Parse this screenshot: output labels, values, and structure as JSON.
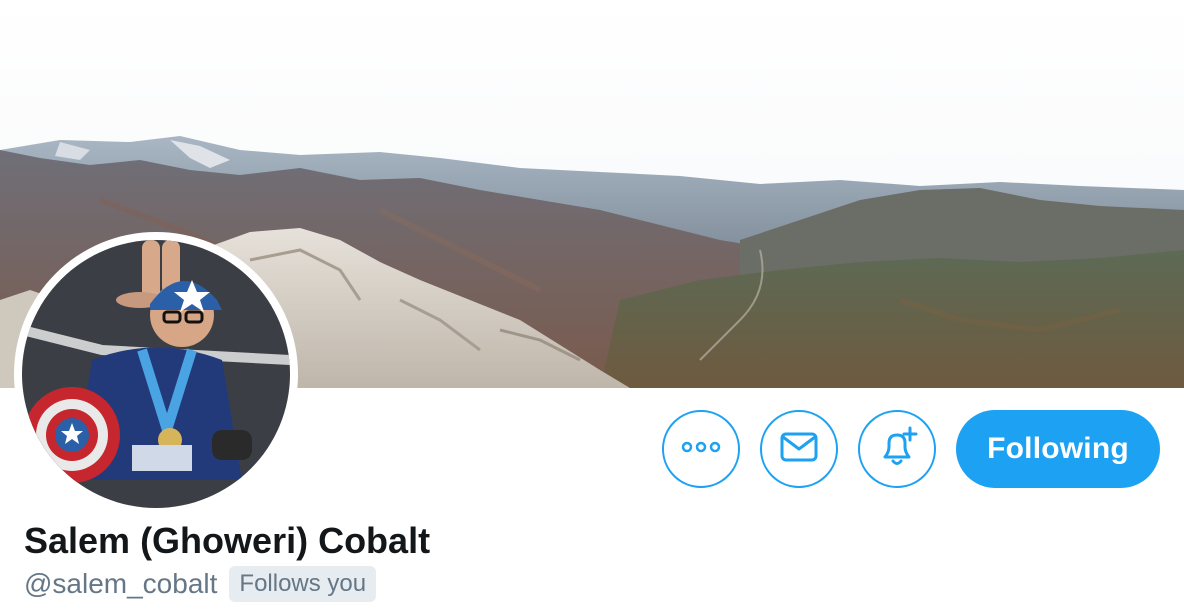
{
  "profile": {
    "display_name": "Salem (Ghoweri) Cobalt",
    "handle": "@salem_cobalt",
    "follows_you_badge": "Follows you"
  },
  "actions": {
    "more_icon": "more-horizontal-icon",
    "message_icon": "envelope-icon",
    "notify_icon": "bell-plus-icon",
    "following_label": "Following"
  },
  "colors": {
    "accent": "#1da1f2",
    "name_text": "#14171a",
    "secondary_text": "#657786",
    "badge_background": "#e6ecf0"
  }
}
